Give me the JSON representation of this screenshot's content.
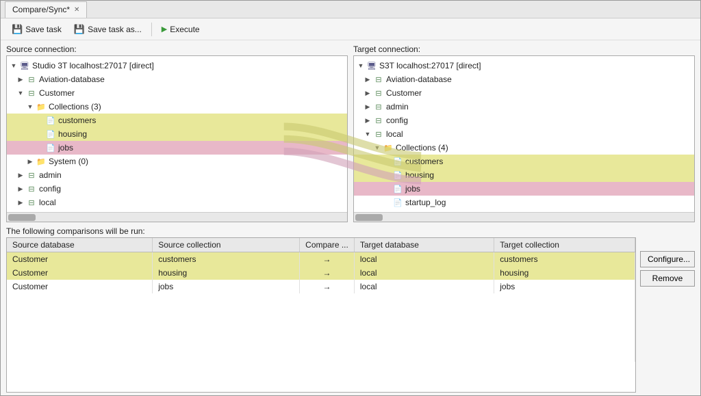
{
  "window": {
    "title": "Compare/Sync*"
  },
  "toolbar": {
    "save_task_label": "Save task",
    "save_task_as_label": "Save task as...",
    "execute_label": "Execute"
  },
  "source": {
    "label": "Source connection:",
    "server": "Studio 3T localhost:27017 [direct]",
    "items": [
      {
        "label": "Aviation-database",
        "type": "db",
        "indent": 1,
        "expanded": false
      },
      {
        "label": "Customer",
        "type": "db",
        "indent": 1,
        "expanded": true
      },
      {
        "label": "Collections (3)",
        "type": "folder",
        "indent": 2,
        "expanded": true
      },
      {
        "label": "customers",
        "type": "collection",
        "indent": 3,
        "selected": "yellow"
      },
      {
        "label": "housing",
        "type": "collection",
        "indent": 3,
        "selected": "yellow"
      },
      {
        "label": "jobs",
        "type": "collection",
        "indent": 3,
        "selected": "pink"
      },
      {
        "label": "System (0)",
        "type": "folder",
        "indent": 2,
        "expanded": false
      },
      {
        "label": "admin",
        "type": "db",
        "indent": 1,
        "expanded": false
      },
      {
        "label": "config",
        "type": "db",
        "indent": 1,
        "expanded": false
      },
      {
        "label": "local",
        "type": "db",
        "indent": 1,
        "expanded": false
      }
    ]
  },
  "target": {
    "label": "Target connection:",
    "server": "S3T localhost:27017 [direct]",
    "items": [
      {
        "label": "Aviation-database",
        "type": "db",
        "indent": 1,
        "expanded": false
      },
      {
        "label": "Customer",
        "type": "db",
        "indent": 1,
        "expanded": false
      },
      {
        "label": "admin",
        "type": "db",
        "indent": 1,
        "expanded": false
      },
      {
        "label": "config",
        "type": "db",
        "indent": 1,
        "expanded": false
      },
      {
        "label": "local",
        "type": "db",
        "indent": 1,
        "expanded": true
      },
      {
        "label": "Collections (4)",
        "type": "folder",
        "indent": 2,
        "expanded": true
      },
      {
        "label": "customers",
        "type": "collection",
        "indent": 3,
        "selected": "yellow"
      },
      {
        "label": "housing",
        "type": "collection",
        "indent": 3,
        "selected": "yellow"
      },
      {
        "label": "jobs",
        "type": "collection",
        "indent": 3,
        "selected": "pink"
      },
      {
        "label": "startup_log",
        "type": "collection",
        "indent": 3,
        "selected": "none"
      }
    ]
  },
  "comparisons": {
    "label": "The following comparisons will be run:",
    "columns": [
      "Source database",
      "Source collection",
      "Compare ...",
      "Target database",
      "Target collection"
    ],
    "rows": [
      {
        "source_db": "Customer",
        "source_col": "customers",
        "arrow": "→",
        "target_db": "local",
        "target_col": "customers",
        "style": "yellow"
      },
      {
        "source_db": "Customer",
        "source_col": "housing",
        "arrow": "→",
        "target_db": "local",
        "target_col": "housing",
        "style": "yellow"
      },
      {
        "source_db": "Customer",
        "source_col": "jobs",
        "arrow": "→",
        "target_db": "local",
        "target_col": "jobs",
        "style": "white"
      }
    ]
  },
  "buttons": {
    "configure_label": "Configure...",
    "remove_label": "Remove"
  },
  "icons": {
    "save": "💾",
    "execute": "▶",
    "server": "🖥",
    "db": "🗃",
    "folder": "📁",
    "collection": "📄",
    "expand": "▶",
    "collapse": "▼",
    "dash": "—"
  }
}
